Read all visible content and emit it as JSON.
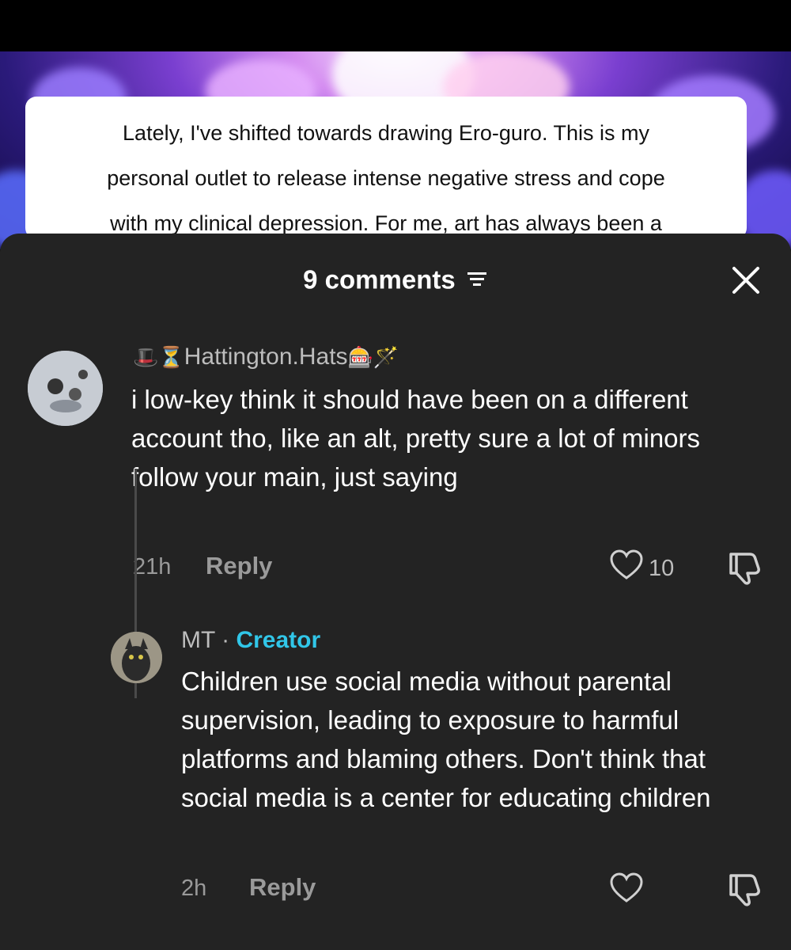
{
  "caption": {
    "text": "Lately, I've shifted towards drawing Ero-guro. This is my\npersonal outlet to release intense negative stress and cope\nwith my clinical depression. For me, art has always been a"
  },
  "comments_panel": {
    "title": "9 comments",
    "filter_icon": "filter-lines-icon",
    "close_icon": "close-x-icon"
  },
  "comments": [
    {
      "username_prefix_emoji": "🎩⏳",
      "username": "Hattington.Hats",
      "username_suffix_emoji": "🎰🪄",
      "text": "i low-key think it should have been on a different account tho, like an alt, pretty sure a lot of minors follow your main, just saying",
      "time": "21h",
      "reply_label": "Reply",
      "likes": "10"
    }
  ],
  "replies": [
    {
      "username": "MT",
      "separator": "·",
      "badge": "Creator",
      "text": "Children use social media without parental supervision, leading to exposure to harmful platforms and blaming others. Don't think that social media is a center for educating children",
      "time": "2h",
      "reply_label": "Reply",
      "likes": ""
    }
  ],
  "colors": {
    "sheet_bg": "#232323",
    "creator_badge": "#31c6e8",
    "muted_text": "#9a9a9a"
  }
}
